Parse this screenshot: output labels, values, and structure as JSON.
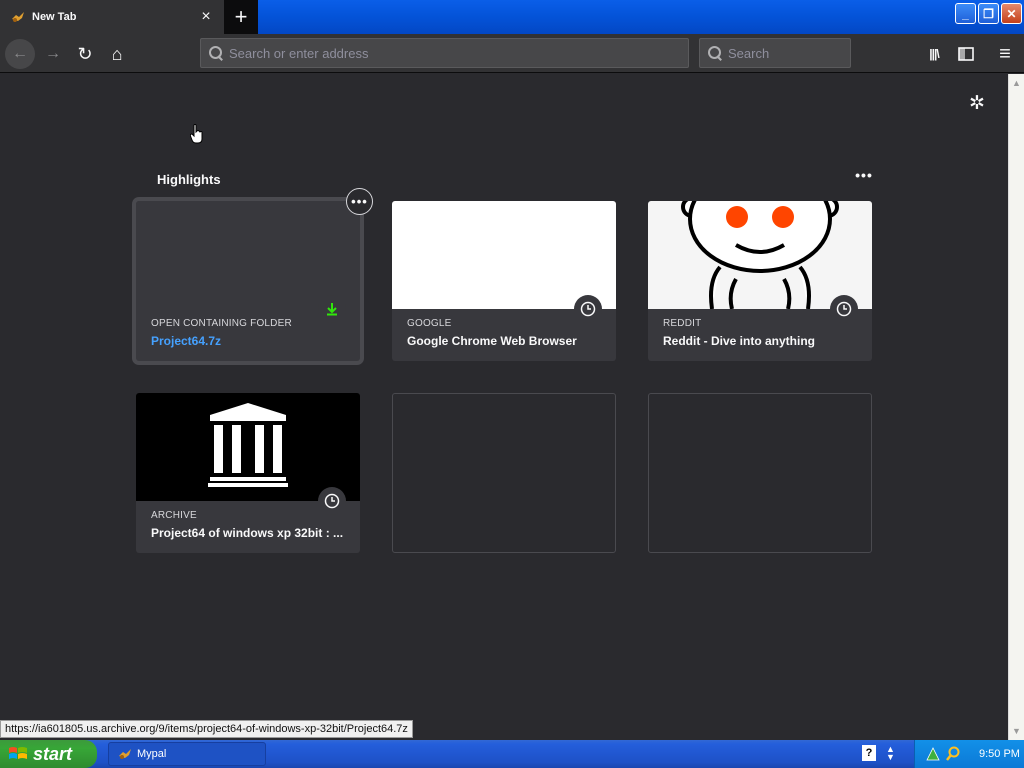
{
  "browser": {
    "tab": {
      "title": "New Tab",
      "close_glyph": "×"
    },
    "new_tab_glyph": "+",
    "window_buttons": {
      "minimize": "_",
      "restore": "❐",
      "close": "✕"
    },
    "nav": {
      "back_glyph": "←",
      "forward_glyph": "→",
      "reload_glyph": "↻",
      "home_glyph": "⌂",
      "url_placeholder": "Search or enter address",
      "search_placeholder": "Search",
      "library_glyph": "|||\\",
      "sidebar_glyph": "▯",
      "menu_glyph": "≡"
    }
  },
  "newtab": {
    "settings_glyph": "✲",
    "highlights": {
      "title": "Highlights",
      "menu_glyph": "•••",
      "context_glyph": "•••",
      "cards": [
        {
          "source": "OPEN CONTAINING FOLDER",
          "title": "Project64.7z",
          "badge": "download-icon"
        },
        {
          "source": "GOOGLE",
          "title": "Google Chrome Web Browser",
          "badge": "clock-icon"
        },
        {
          "source": "REDDIT",
          "title": "Reddit - Dive into anything",
          "badge": "clock-icon"
        },
        {
          "source": "ARCHIVE",
          "title": "Project64 of windows xp 32bit : ...",
          "badge": "clock-icon"
        }
      ]
    }
  },
  "status_url": "https://ia601805.us.archive.org/9/items/project64-of-windows-xp-32bit/Project64.7z",
  "taskbar": {
    "start_label": "start",
    "task_label": "Mypal",
    "help_glyph": "?",
    "clock": "9:50 PM"
  },
  "colors": {
    "accent_link": "#45a1ff",
    "download_green": "#30e60b",
    "reddit_eye": "#ff4500"
  }
}
